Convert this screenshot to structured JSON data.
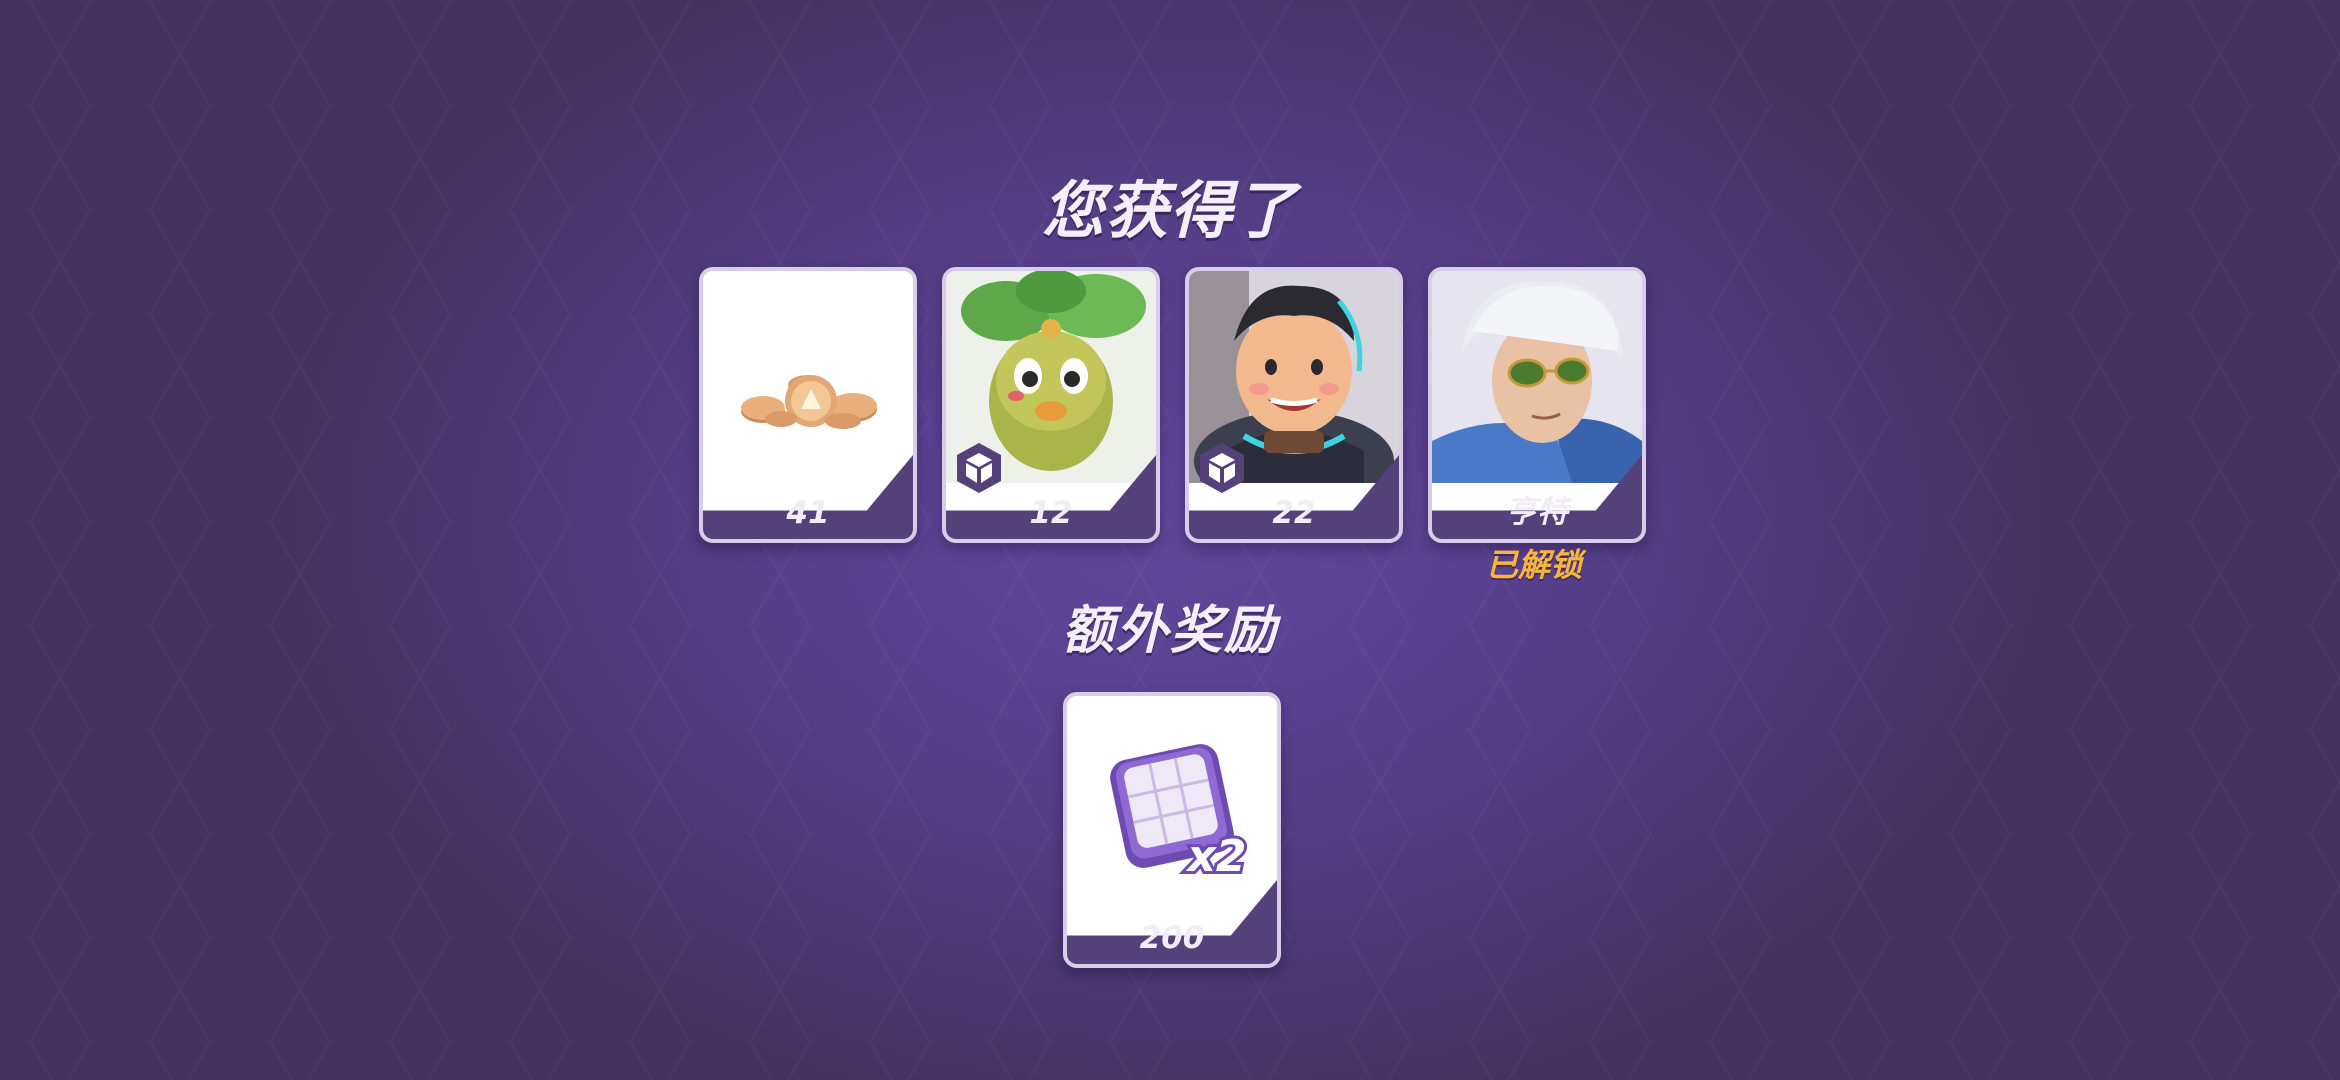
{
  "header": {
    "title": "您获得了"
  },
  "rewards": [
    {
      "name": "coins",
      "count": "41",
      "icon": "coin-stack-icon"
    },
    {
      "name": "character-shard-plant",
      "count": "12",
      "icon": "shard-icon"
    },
    {
      "name": "character-shard-astronaut",
      "count": "22",
      "icon": "shard-icon"
    },
    {
      "name": "character-hunter",
      "label": "亨特",
      "status": "已解锁"
    }
  ],
  "bonus": {
    "title": "额外奖励",
    "item": {
      "name": "double-card",
      "count": "200",
      "icon": "x2-card-icon"
    }
  },
  "colors": {
    "background": "#5a4190",
    "card_footer": "#55417a",
    "card_border": "#d8cde8",
    "unlocked_text": "#f7b63a"
  }
}
